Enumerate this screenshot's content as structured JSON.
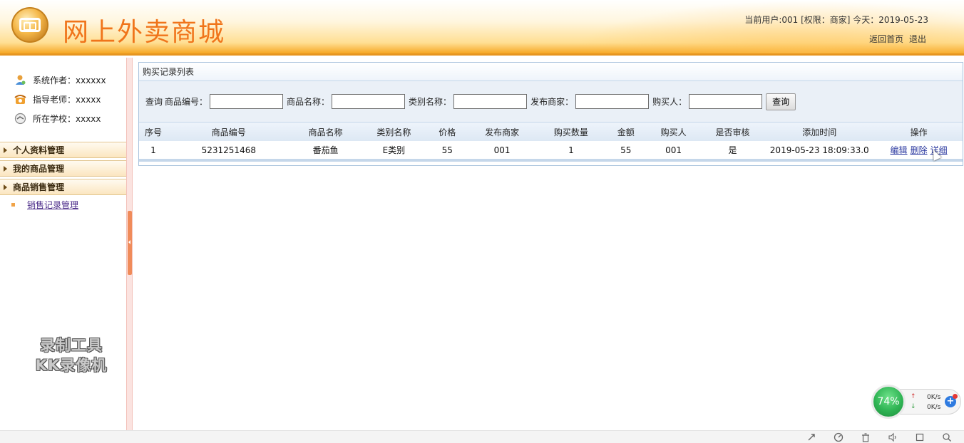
{
  "header": {
    "site_title": "网上外卖商城",
    "user_info": "当前用户:001 [权限：商家] 今天：2019-05-23",
    "home_link": "返回首页",
    "logout_link": "退出"
  },
  "sidebar": {
    "info": [
      {
        "label": "系统作者：xxxxxx",
        "icon": "user-icon"
      },
      {
        "label": "指导老师：xxxxx",
        "icon": "phone-icon"
      },
      {
        "label": "所在学校：xxxxx",
        "icon": "school-icon"
      }
    ],
    "menus": [
      {
        "label": "个人资料管理"
      },
      {
        "label": "我的商品管理"
      },
      {
        "label": "商品销售管理"
      }
    ],
    "submenu": {
      "label": "销售记录管理"
    }
  },
  "watermark": {
    "line1": "录制工具",
    "line2": "KK录像机"
  },
  "panel": {
    "title": "购买记录列表"
  },
  "search": {
    "prefix": "查询",
    "fields": [
      {
        "label": "商品编号："
      },
      {
        "label": "商品名称："
      },
      {
        "label": "类别名称："
      },
      {
        "label": "发布商家："
      },
      {
        "label": "购买人："
      }
    ],
    "button": "查询"
  },
  "table": {
    "headers": [
      "序号",
      "商品编号",
      "商品名称",
      "类别名称",
      "价格",
      "发布商家",
      "购买数量",
      "金额",
      "购买人",
      "是否审核",
      "添加时间",
      "操作"
    ],
    "rows": [
      [
        "1",
        "5231251468",
        "番茄鱼",
        "E类别",
        "55",
        "001",
        "1",
        "55",
        "001",
        "是",
        "2019-05-23 18:09:33.0"
      ]
    ],
    "ops": [
      "编辑",
      "删除",
      "详细"
    ]
  },
  "net_widget": {
    "percent": "74%",
    "up": "0K/s",
    "down": "0K/s"
  },
  "colors": {
    "title_orange": "#f0741a",
    "header_border": "#e69520",
    "panel_border": "#a9c3dd",
    "link_blue": "#2c3aa0"
  }
}
